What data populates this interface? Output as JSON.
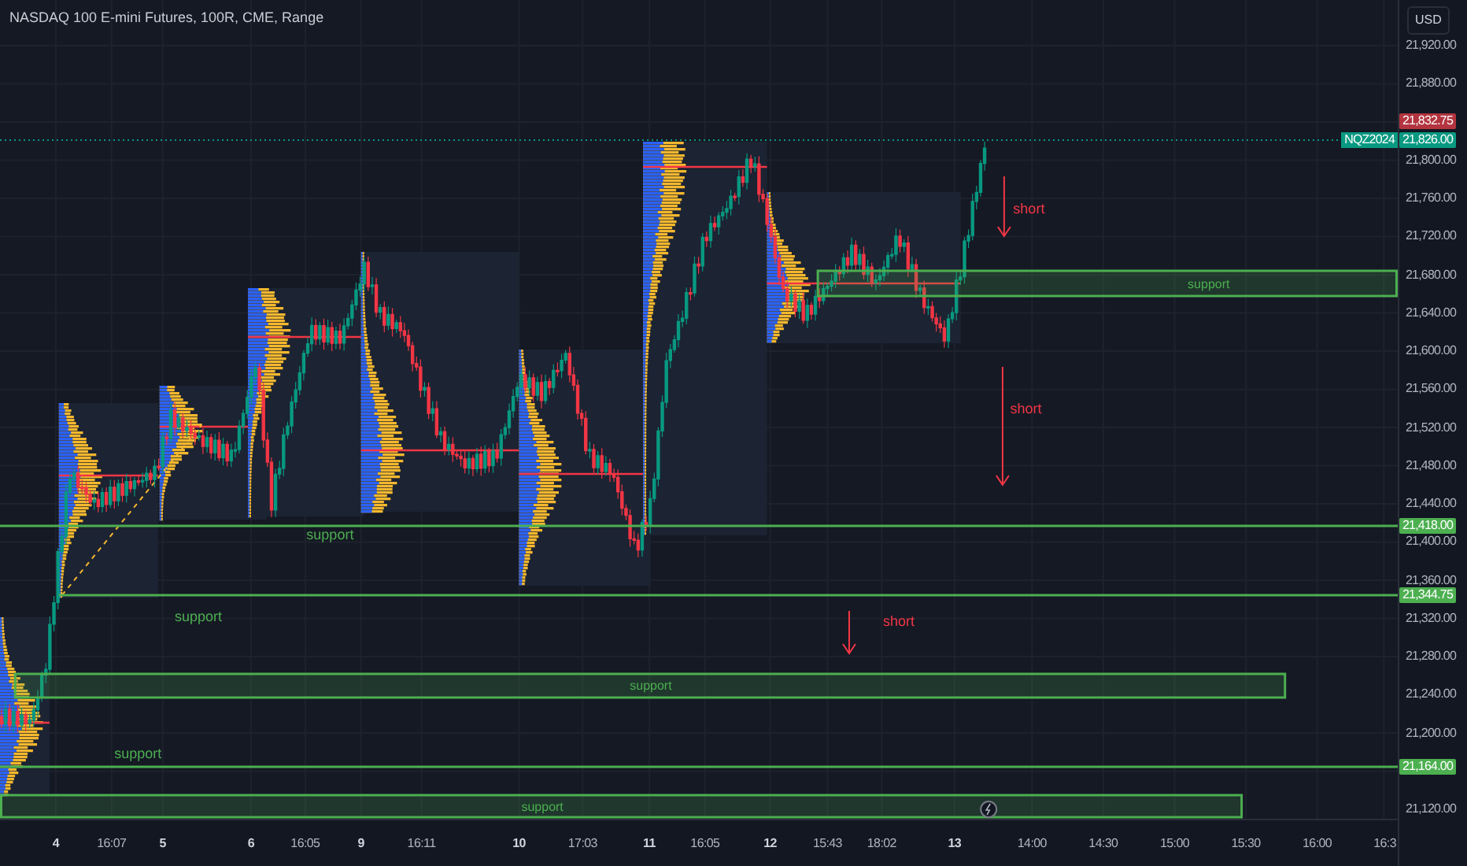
{
  "title": "NASDAQ 100 E-mini Futures, 100R, CME, Range",
  "currency": "USD",
  "price_ticks": [
    "21,920.00",
    "21,880.00",
    "21,800.00",
    "21,760.00",
    "21,720.00",
    "21,680.00",
    "21,640.00",
    "21,600.00",
    "21,560.00",
    "21,520.00",
    "21,480.00",
    "21,440.00",
    "21,400.00",
    "21,360.00",
    "21,320.00",
    "21,280.00",
    "21,240.00",
    "21,200.00",
    "21,120.00"
  ],
  "price_badges": [
    {
      "value": "21,832.75",
      "color": "#b2343f"
    },
    {
      "symbol": "NQZ2024",
      "value": "21,826.00",
      "color": "#089981"
    },
    {
      "value": "21,418.00",
      "color": "#4caf50"
    },
    {
      "value": "21,344.75",
      "color": "#4caf50"
    },
    {
      "value": "21,164.00",
      "color": "#4caf50"
    }
  ],
  "time_labels": [
    {
      "label": "4",
      "kind": "day"
    },
    {
      "label": "16:07",
      "kind": "time"
    },
    {
      "label": "5",
      "kind": "day"
    },
    {
      "label": "6",
      "kind": "day"
    },
    {
      "label": "16:05",
      "kind": "time"
    },
    {
      "label": "9",
      "kind": "day"
    },
    {
      "label": "16:11",
      "kind": "time"
    },
    {
      "label": "10",
      "kind": "day"
    },
    {
      "label": "17:03",
      "kind": "time"
    },
    {
      "label": "11",
      "kind": "day"
    },
    {
      "label": "16:05",
      "kind": "time"
    },
    {
      "label": "12",
      "kind": "day"
    },
    {
      "label": "15:43",
      "kind": "time"
    },
    {
      "label": "18:02",
      "kind": "time"
    },
    {
      "label": "13",
      "kind": "day"
    },
    {
      "label": "14:00",
      "kind": "time"
    },
    {
      "label": "14:30",
      "kind": "time"
    },
    {
      "label": "15:00",
      "kind": "time"
    },
    {
      "label": "15:30",
      "kind": "time"
    },
    {
      "label": "16:00",
      "kind": "time"
    },
    {
      "label": "16:3",
      "kind": "time"
    }
  ],
  "zones": [
    {
      "label": "support"
    },
    {
      "label": "support"
    },
    {
      "label": "support"
    }
  ],
  "support_lines": [
    {
      "label": "support"
    },
    {
      "label": "support"
    },
    {
      "label": "support"
    }
  ],
  "short_arrows": [
    {
      "label": "short"
    },
    {
      "label": "short"
    },
    {
      "label": "short"
    }
  ]
}
